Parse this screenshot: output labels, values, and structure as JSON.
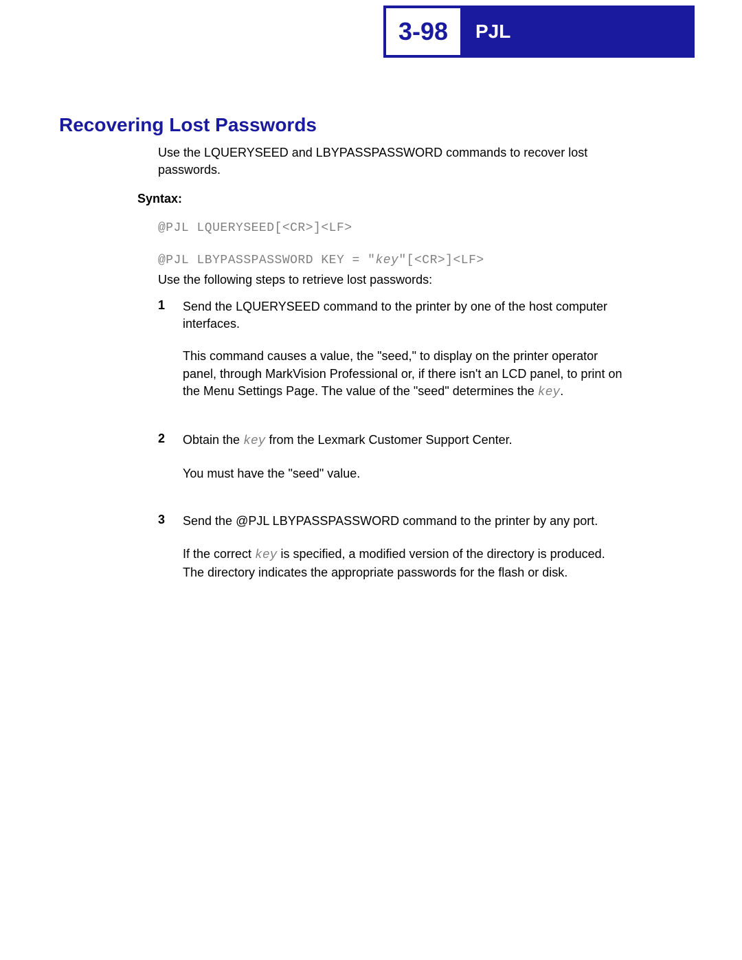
{
  "header": {
    "page_number": "3-98",
    "title": "PJL"
  },
  "section": {
    "heading": "Recovering Lost Passwords",
    "intro": "Use the LQUERYSEED and LBYPASSPASSWORD commands to recover lost passwords.",
    "syntax_label": "Syntax:",
    "syntax_line_1": "@PJL LQUERYSEED[<CR>]<LF>",
    "syntax_line_2_pre": "@PJL LBYPASSPASSWORD KEY = \"",
    "syntax_key": "key",
    "syntax_line_2_post": "\"[<CR>]<LF>",
    "steps_intro": "Use the following steps to retrieve lost passwords:",
    "steps": [
      {
        "num": "1",
        "p1": "Send the LQUERYSEED command to the printer by one of the host computer interfaces.",
        "p2_pre": "This command causes a value, the \"seed,\" to display on the printer operator panel, through MarkVision Professional or, if there isn't an LCD panel, to print on the Menu Settings Page. The value of the \"seed\" determines the ",
        "p2_key": "key",
        "p2_post": "."
      },
      {
        "num": "2",
        "p1_pre": "Obtain the ",
        "p1_key": "key",
        "p1_post": " from the Lexmark Customer Support Center.",
        "p2": "You must have the \"seed\" value."
      },
      {
        "num": "3",
        "p1": "Send the @PJL LBYPASSPASSWORD command to the printer by any port.",
        "p2_pre": "If the correct ",
        "p2_key": "key",
        "p2_post": " is specified, a modified version of the directory is produced. The directory indicates the appropriate passwords for the flash or disk."
      }
    ]
  }
}
